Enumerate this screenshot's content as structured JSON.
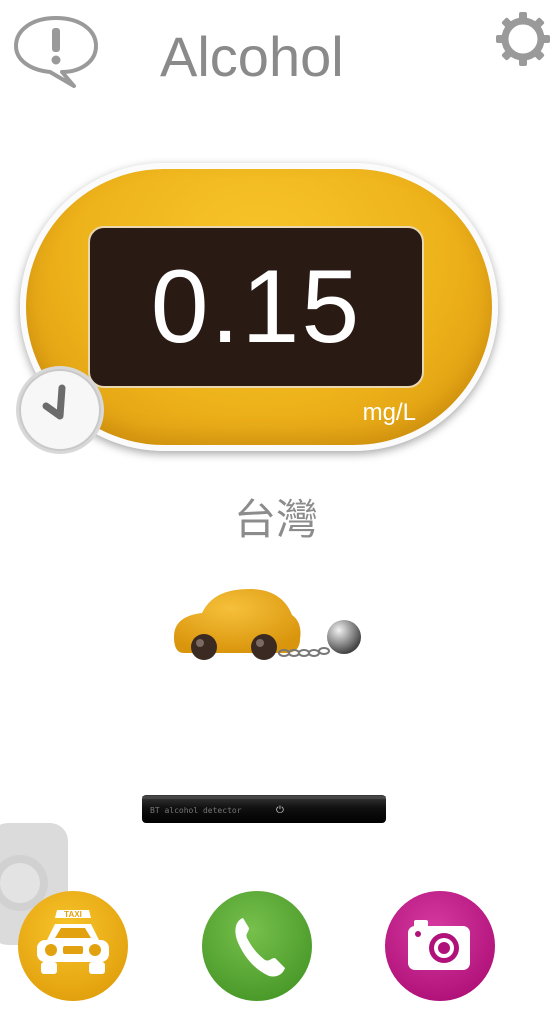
{
  "header": {
    "title": "Alcohol",
    "alert_icon": "alert-speech-bubble-icon",
    "settings_icon": "gear-icon"
  },
  "reading": {
    "value": "0.15",
    "unit": "mg/L",
    "history_icon": "clock-icon"
  },
  "region": {
    "label": "台灣"
  },
  "status": {
    "illustration": "car-with-ball-and-chain-icon"
  },
  "device": {
    "label": "BT alcohol detector",
    "power_symbol": "⏻"
  },
  "actions": {
    "taxi_label": "TAXI",
    "taxi_icon": "taxi-icon",
    "call_icon": "phone-icon",
    "camera_icon": "camera-icon"
  },
  "colors": {
    "accent_orange": "#eeb31b",
    "display_bg": "#2a1a14",
    "call_green": "#5aa632",
    "camera_magenta": "#c01a86",
    "title_gray": "#8a8a8a"
  }
}
